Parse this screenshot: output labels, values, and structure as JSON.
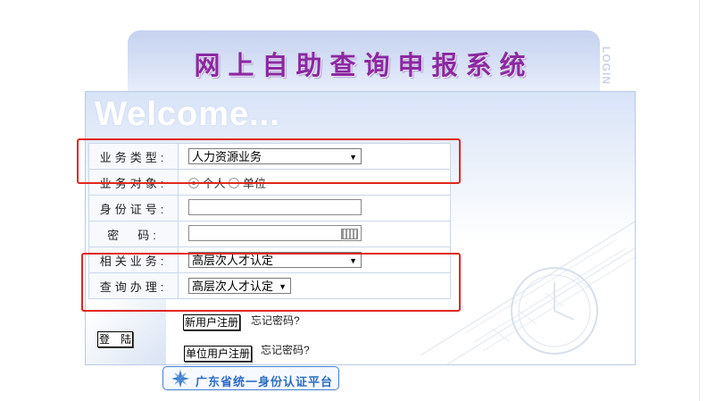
{
  "header": {
    "title": "网上自助查询申报系统",
    "side_label": "LOGIN"
  },
  "panel": {
    "welcome": "Welcome..."
  },
  "form": {
    "business_type": {
      "label": "业务类型:",
      "value": "人力资源业务"
    },
    "target": {
      "label": "业务对象:",
      "option_person": "个人",
      "option_unit": "单位",
      "selected": "个人"
    },
    "id_number": {
      "label": "身份证号:",
      "value": ""
    },
    "password": {
      "label": "密　码:",
      "value": ""
    },
    "related_business": {
      "label": "相关业务:",
      "value": "高层次人才认定"
    },
    "query_handle": {
      "label": "查询办理:",
      "value": "高层次人才认定"
    }
  },
  "actions": {
    "login": "登　陆",
    "new_user_register": "新用户注册",
    "forgot_password_1": "忘记密码?",
    "unit_user_register": "单位用户注册",
    "forgot_password_2": "忘记密码?"
  },
  "footer": {
    "auth_platform": "广东省统一身份认证平台"
  },
  "colors": {
    "highlight": "#e0271f",
    "title": "#8a2aa0",
    "auth": "#2b6cc4"
  }
}
